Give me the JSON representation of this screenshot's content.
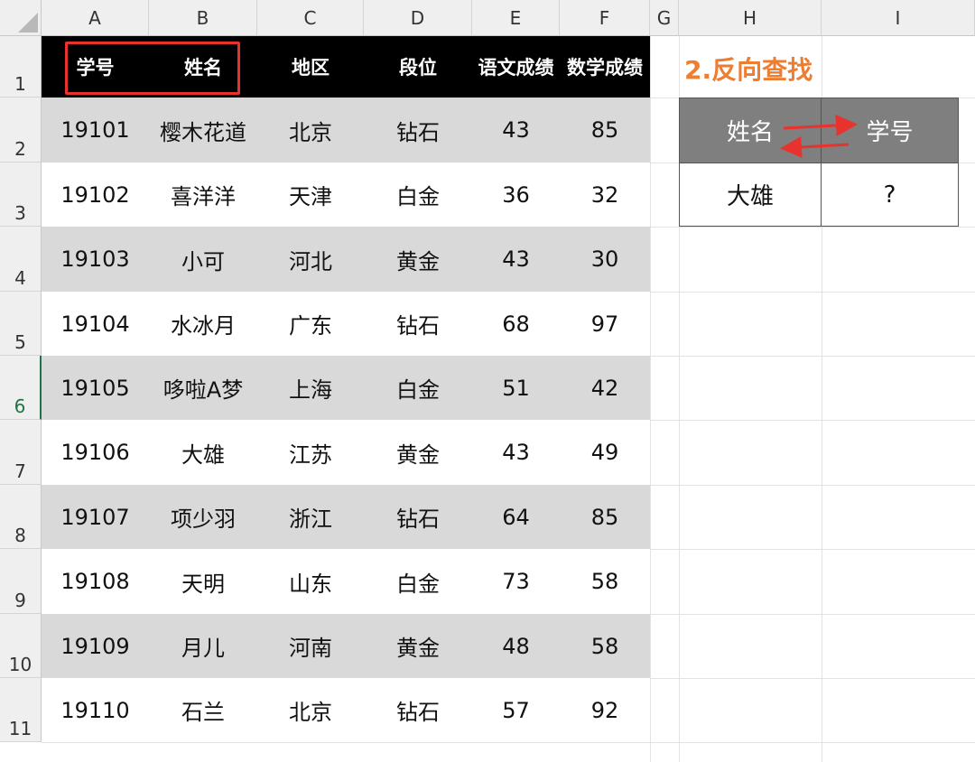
{
  "spreadsheet": {
    "column_letters": [
      "A",
      "B",
      "C",
      "D",
      "E",
      "F",
      "G",
      "H",
      "I"
    ],
    "row_numbers": [
      "1",
      "2",
      "3",
      "4",
      "5",
      "6",
      "7",
      "8",
      "9",
      "10",
      "11"
    ],
    "selected_row": "6",
    "table": {
      "headers": [
        "学号",
        "姓名",
        "地区",
        "段位",
        "语文成绩",
        "数学成绩"
      ],
      "rows": [
        [
          "19101",
          "樱木花道",
          "北京",
          "钻石",
          "43",
          "85"
        ],
        [
          "19102",
          "喜洋洋",
          "天津",
          "白金",
          "36",
          "32"
        ],
        [
          "19103",
          "小可",
          "河北",
          "黄金",
          "43",
          "30"
        ],
        [
          "19104",
          "水冰月",
          "广东",
          "钻石",
          "68",
          "97"
        ],
        [
          "19105",
          "哆啦A梦",
          "上海",
          "白金",
          "51",
          "42"
        ],
        [
          "19106",
          "大雄",
          "江苏",
          "黄金",
          "43",
          "49"
        ],
        [
          "19107",
          "项少羽",
          "浙江",
          "钻石",
          "64",
          "85"
        ],
        [
          "19108",
          "天明",
          "山东",
          "白金",
          "73",
          "58"
        ],
        [
          "19109",
          "月儿",
          "河南",
          "黄金",
          "48",
          "58"
        ],
        [
          "19110",
          "石兰",
          "北京",
          "钻石",
          "57",
          "92"
        ]
      ]
    },
    "highlighted_columns": [
      "学号",
      "姓名"
    ]
  },
  "lookup": {
    "title": "2.反向查找",
    "header_left": "姓名",
    "header_right": "学号",
    "value_left": "大雄",
    "value_right": "?"
  },
  "colors": {
    "header_fill": "#000000",
    "band_fill": "#d9d9d9",
    "highlight_border": "#e8322d",
    "title_color": "#ed7d31",
    "lookup_header_fill": "#7f7f7f",
    "arrow_color": "#e8322d"
  }
}
